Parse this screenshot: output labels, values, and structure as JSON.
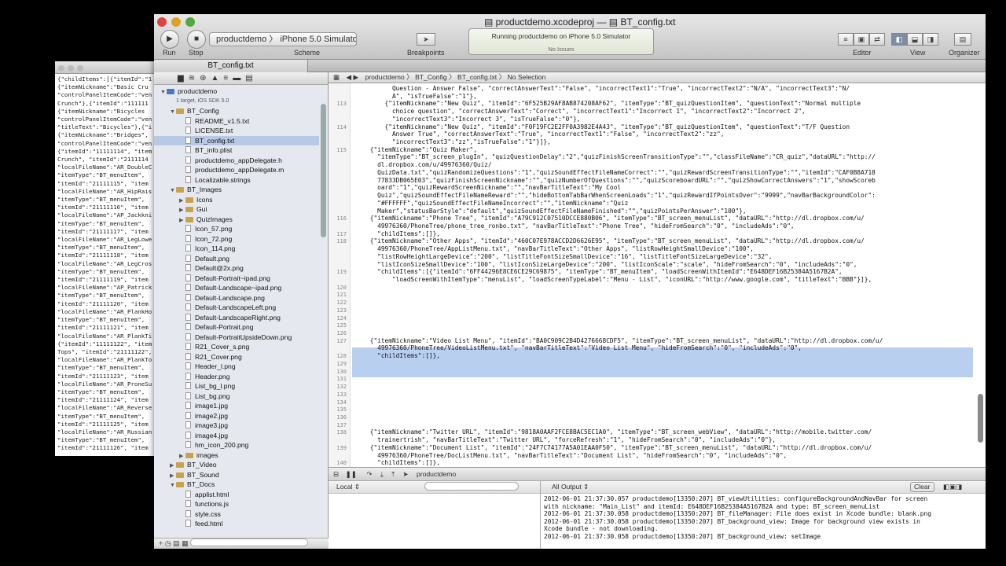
{
  "background_window": {
    "lines": [
      "{\"childItems\":[{\"itemId\":\"1",
      "{\"itemNickname\":\"Basic Cru",
      "\"controlPanelItemCode\":\"ven",
      "Crunch\"},{\"itemId\":\"111111",
      "{\"itemNickname\":\"Bicycles",
      "\"controlPanelItemCode\":\"ven",
      "\"titleText\":\"Bicycles\"},{\"i",
      "{\"itemNickname\":\"Bridges\",",
      "\"controlPanelItemCode\":\"ven",
      "{\"itemId\":\"11111114\", \"item",
      "Crunch\", \"itemId\":\"2111114",
      "\"localFileName\":\"AR_DoubleC",
      "\"itemType\":\"BT_menuItem\",",
      "\"itemId\":\"21111115\", \"item",
      "\"localFileName\":\"AR_HipRais",
      "\"itemType\":\"BT_menuItem\",",
      "\"itemId\":\"21111116\", \"item",
      "\"localFileName\":\"AP_Jackkni",
      "\"itemType\":\"BT_menuItem\",",
      "\"itemId\":\"21111117\", \"item",
      "\"localFileName\":\"AR_LegLowe",
      "\"itemType\":\"BT_menuItem\",",
      "\"itemId\":\"21111118\", \"item",
      "\"localFileName\":\"AR_LegCros",
      "\"itemType\":\"BT_menuItem\",",
      "\"itemId\":\"21111119\", \"item",
      "\"localFileName\":\"AP_Patrick",
      "\"itemType\":\"BT_menuItem\",",
      "\"itemId\":\"21111120\", \"item",
      "\"localFileName\":\"AR_PlankHo",
      "\"itemType\":\"BT_menuItem\",",
      "\"itemId\":\"21111121\", \"item",
      "\"localFileName\":\"AR_PlankTi",
      "{\"itemId\":\"11111122\", \"item",
      "Tops\", \"itemId\":\"21111122\",",
      "\"localFileName\":\"AR_PlankTo",
      "\"itemType\":\"BT_menuItem\",",
      "\"itemId\":\"21111123\", \"item",
      "\"localFileName\":\"AR_ProneSu",
      "\"itemType\":\"BT_menuItem\",",
      "\"itemId\":\"21111124\", \"item",
      "\"localFileName\":\"AR_Reverse",
      "\"itemType\":\"BT_menuItem\",",
      "\"itemId\":\"21111125\", \"item",
      "\"localFileName\":\"AR_Russian",
      "\"itemType\":\"BT_menuItem\",",
      "\"itemId\":\"21111126\", \"item"
    ]
  },
  "window": {
    "title_project": "productdemo.xcodeproj",
    "title_sep": "—",
    "title_file": "BT_config.txt",
    "run_label": "Run",
    "stop_label": "Stop",
    "scheme_label": "Scheme",
    "scheme_text": "productdemo 〉 iPhone 5.0 Simulator",
    "breakpoints_label": "Breakpoints",
    "activity_line1": "Running productdemo on iPhone 5.0 Simulator",
    "activity_line2": "No Issues",
    "editor_label": "Editor",
    "view_label": "View",
    "organizer_label": "Organizer",
    "tab_title": "BT_config.txt"
  },
  "navigator": {
    "items": [
      {
        "label": "productdemo",
        "indent": 0,
        "kind": "proj",
        "open": true
      },
      {
        "label": "1 target, iOS SDK 5.0",
        "indent": 1,
        "kind": "sub"
      },
      {
        "label": "BT_Config",
        "indent": 1,
        "kind": "folder",
        "open": true
      },
      {
        "label": "README_v1.5.txt",
        "indent": 2,
        "kind": "file"
      },
      {
        "label": "LICENSE.txt",
        "indent": 2,
        "kind": "file"
      },
      {
        "label": "BT_config.txt",
        "indent": 2,
        "kind": "file",
        "selected": true
      },
      {
        "label": "BT_info.plist",
        "indent": 2,
        "kind": "file"
      },
      {
        "label": "productdemo_appDelegate.h",
        "indent": 2,
        "kind": "file"
      },
      {
        "label": "productdemo_appDelegate.m",
        "indent": 2,
        "kind": "file"
      },
      {
        "label": "Localizable.strings",
        "indent": 2,
        "kind": "file"
      },
      {
        "label": "BT_Images",
        "indent": 1,
        "kind": "folder",
        "open": true
      },
      {
        "label": "Icons",
        "indent": 2,
        "kind": "folder"
      },
      {
        "label": "Gui",
        "indent": 2,
        "kind": "folder"
      },
      {
        "label": "QuizImages",
        "indent": 2,
        "kind": "folder"
      },
      {
        "label": "Icon_57.png",
        "indent": 2,
        "kind": "file"
      },
      {
        "label": "Icon_72.png",
        "indent": 2,
        "kind": "file"
      },
      {
        "label": "Icon_114.png",
        "indent": 2,
        "kind": "file"
      },
      {
        "label": "Default.png",
        "indent": 2,
        "kind": "file"
      },
      {
        "label": "Default@2x.png",
        "indent": 2,
        "kind": "file"
      },
      {
        "label": "Default-Portrait~ipad.png",
        "indent": 2,
        "kind": "file"
      },
      {
        "label": "Default-Landscape~ipad.png",
        "indent": 2,
        "kind": "file"
      },
      {
        "label": "Default-Landscape.png",
        "indent": 2,
        "kind": "file"
      },
      {
        "label": "Default-LandscapeLeft.png",
        "indent": 2,
        "kind": "file"
      },
      {
        "label": "Default-LandscapeRight.png",
        "indent": 2,
        "kind": "file"
      },
      {
        "label": "Default-Portrait.png",
        "indent": 2,
        "kind": "file"
      },
      {
        "label": "Default-PortraitUpsideDown.png",
        "indent": 2,
        "kind": "file"
      },
      {
        "label": "R21_Cover_s.png",
        "indent": 2,
        "kind": "file"
      },
      {
        "label": "R21_Cover.png",
        "indent": 2,
        "kind": "file"
      },
      {
        "label": "Header_l.png",
        "indent": 2,
        "kind": "file"
      },
      {
        "label": "Header.png",
        "indent": 2,
        "kind": "file"
      },
      {
        "label": "List_bg_l.png",
        "indent": 2,
        "kind": "file"
      },
      {
        "label": "List_bg.png",
        "indent": 2,
        "kind": "file"
      },
      {
        "label": "image1.jpg",
        "indent": 2,
        "kind": "file"
      },
      {
        "label": "image2.jpg",
        "indent": 2,
        "kind": "file"
      },
      {
        "label": "image3.jpg",
        "indent": 2,
        "kind": "file"
      },
      {
        "label": "image4.jpg",
        "indent": 2,
        "kind": "file"
      },
      {
        "label": "hm_icon_200.png",
        "indent": 2,
        "kind": "file"
      },
      {
        "label": "images",
        "indent": 2,
        "kind": "folder"
      },
      {
        "label": "BT_Video",
        "indent": 1,
        "kind": "folder"
      },
      {
        "label": "BT_Sound",
        "indent": 1,
        "kind": "folder"
      },
      {
        "label": "BT_Docs",
        "indent": 1,
        "kind": "folder",
        "open": true
      },
      {
        "label": "applist.html",
        "indent": 2,
        "kind": "file"
      },
      {
        "label": "functions.js",
        "indent": 2,
        "kind": "file"
      },
      {
        "label": "style.css",
        "indent": 2,
        "kind": "file"
      },
      {
        "label": "feed.html",
        "indent": 2,
        "kind": "file"
      }
    ],
    "bottom_bar": "+"
  },
  "jumpbar": {
    "crumbs": [
      "productdemo",
      "BT_Config",
      "BT_config.txt",
      "No Selection"
    ]
  },
  "editor": {
    "lines": [
      {
        "n": "",
        "t": "          Question - Answer False\", \"correctAnswerText\":\"False\", \"incorrectText1\":\"True\", \"incorrectText2\":\"N/A\", \"incorrectText3\":\"N/"
      },
      {
        "n": "",
        "t": "          A\", \"isTrueFalse\":\"1\"},"
      },
      {
        "n": "113",
        "t": "        {\"itemNickname\":\"New Quiz\", \"itemId\":\"6F525B29AF8AB874208AF62\", \"itemType\":\"BT_quizQuestionItem\", \"questionText\":\"Normal multiple"
      },
      {
        "n": "",
        "t": "          choice question\", \"correctAnswerText\":\"Correct\", \"incorrectText1\":\"Incorrect 1\", \"incorrectText2\":\"Incorrect 2\","
      },
      {
        "n": "",
        "t": "          \"incorrectText3\":\"Incorrect 3\", \"isTrueFalse\":\"0\"},"
      },
      {
        "n": "114",
        "t": "        {\"itemNickname\":\"New Quiz\", \"itemId\":\"F0F19FC2E2FF0A3982E4A43\", \"itemType\":\"BT_quizQuestionItem\", \"questionText\":\"T/F Question"
      },
      {
        "n": "",
        "t": "          Answer True\", \"correctAnswerText\":\"True\", \"incorrectText1\":\"False\", \"incorrectText2\":\"zz\","
      },
      {
        "n": "",
        "t": "          \"incorrectText3\":\"zz\",\"isTrueFalse\":\"1\"}]},"
      },
      {
        "n": "115",
        "t": "    {\"itemNickname\":\"Quiz Maker\","
      },
      {
        "n": "",
        "t": "      \"itemType\":\"BT_screen_plugIn\", \"quizQuestionDelay\":\"2\",\"quizFinishScreenTransitionType\":\"\",\"classFileName\":\"CR_quiz\",\"dataURL\":\"http://"
      },
      {
        "n": "",
        "t": "      dl.dropbox.com/u/49976360/Quiz/"
      },
      {
        "n": "",
        "t": "      QuizData.txt\",\"quizRandomizeQuestions\":\"1\",\"quizSoundEffectFileNameCorrect\":\"\",\"quizRewardScreenTransitionType\":\"\",\"itemId\":\"CAF0B8A718"
      },
      {
        "n": "",
        "t": "      77833DB065E03\",\"quizFinishScreenNickname\":\"\",\"quizNumberOfQuestions\":\"\",\"quizScoreboardURL\":\"\",\"quizShowCorrectAnswers\":\"1\",\"showScoreb"
      },
      {
        "n": "",
        "t": "      oard\":\"1\",\"quizRewardScreenNickname\":\"\",\"navBarTitleText\":\"My Cool"
      },
      {
        "n": "",
        "t": "      Quiz\",\"quizSoundEffectFileNameReward\":\"\",\"hideBottomTabBarWhenScreenLoads\":\"1\",\"quizRewardIfPointsOver\":\"9999\",\"navBarBackgroundColor\":"
      },
      {
        "n": "",
        "t": "      \"#FFFFFF\",\"quizSoundEffectFileNameIncorrect\":\"\",\"itemNickname\":\"Quiz"
      },
      {
        "n": "",
        "t": "      Maker\",\"statusBarStyle\":\"default\",\"quizSoundEffectFileNameFinished\":\"\",\"quizPointsPerAnswer\":\"100\"},"
      },
      {
        "n": "116",
        "t": "    {\"itemNickname\":\"Phone Tree\", \"itemId\":\"A79C912C07510DCCE880B06\", \"itemType\":\"BT_screen_menuList\", \"dataURL\":\"http://dl.dropbox.com/u/"
      },
      {
        "n": "",
        "t": "      49976360/PhoneTree/phone_tree_ronbo.txt\", \"navBarTitleText\":\"Phone Tree\", \"hideFromSearch\":\"0\", \"includeAds\":\"0\","
      },
      {
        "n": "117",
        "t": "      \"childItems\":[]},"
      },
      {
        "n": "118",
        "t": "    {\"itemNickname\":\"Other Apps\", \"itemId\":\"460C07E978ACCD2D6626E95\", \"itemType\":\"BT_screen_menuList\", \"dataURL\":\"http://dl.dropbox.com/u/"
      },
      {
        "n": "",
        "t": "      49976360/PhoneTree/AppListMenu.txt\", \"navBarTitleText\":\"Other Apps\", \"listRowHeightSmallDevice\":\"100\","
      },
      {
        "n": "",
        "t": "      \"listRowHeightLargeDevice\":\"200\", \"listTitleFontSizeSmallDevice\":\"16\", \"listTitleFontSizeLargeDevice\":\"32\","
      },
      {
        "n": "",
        "t": "      \"listIconSizeSmallDevice\":\"100\", \"listIconSizeLargeDevice\":\"200\", \"listIconScale\":\"scale\", \"hideFromSearch\":\"0\", \"includeAds\":\"0\","
      },
      {
        "n": "119",
        "t": "      \"childItems\":[{\"itemId\":\"6FF44296E8CE6CE29C69875\", \"itemType\":\"BT_menuItem\", \"loadScreenWithItemId\":\"E648DEF16B25384A5167B2A\","
      },
      {
        "n": "",
        "t": "          \"loadScreenWithItemType\":\"menuList\", \"loadScreenTypeLabel\":\"Menu - List\", \"iconURL\":\"http://www.google.com\", \"titleText\":\"BBB\"}]},"
      },
      {
        "n": "120",
        "t": ""
      },
      {
        "n": "121",
        "t": ""
      },
      {
        "n": "122",
        "t": ""
      },
      {
        "n": "123",
        "t": ""
      },
      {
        "n": "124",
        "t": ""
      },
      {
        "n": "125",
        "t": ""
      },
      {
        "n": "126",
        "t": ""
      },
      {
        "n": "127",
        "t": "    {\"itemNickname\":\"Video List Menu\", \"itemId\":\"BA0C909C2B4D4276668CDF5\", \"itemType\":\"BT_screen_menuList\", \"dataURL\":\"http://dl.dropbox.com/u/"
      },
      {
        "n": "",
        "t": "      49976360/PhoneTree/VideoListMenu.txt\", \"navBarTitleText\":\"Video List Menu\", \"hideFromSearch\":\"0\", \"includeAds\":\"0\","
      },
      {
        "n": "128",
        "t": "      \"childItems\":[]},"
      },
      {
        "n": "129",
        "t": ""
      },
      {
        "n": "130",
        "t": ""
      },
      {
        "n": "131",
        "t": ""
      },
      {
        "n": "132",
        "t": ""
      },
      {
        "n": "133",
        "t": ""
      },
      {
        "n": "134",
        "t": ""
      },
      {
        "n": "135",
        "t": ""
      },
      {
        "n": "136",
        "t": ""
      },
      {
        "n": "137",
        "t": ""
      },
      {
        "n": "138",
        "t": "    {\"itemNickname\":\"Twitter URL\", \"itemId\":\"9818A0AAF2FCE8BAC5EC1A0\", \"itemType\":\"BT_screen_webView\", \"dataURL\":\"http://mobile.twitter.com/"
      },
      {
        "n": "",
        "t": "      trainertrish\", \"navBarTitleText\":\"Twitter URL\", \"forceRefresh\":\"1\", \"hideFromSearch\":\"0\", \"includeAds\":\"0\"},"
      },
      {
        "n": "139",
        "t": "    {\"itemNickname\":\"Document List\", \"itemId\":\"24F7C74177A5A01EAA0F50\", \"itemType\":\"BT_screen_menuList\", \"dataURL\":\"http://dl.dropbox.com/u/"
      },
      {
        "n": "",
        "t": "      49976360/PhoneTree/DocListMenu.txt\", \"navBarTitleText\":\"Document List\", \"hideFromSearch\":\"0\", \"includeAds\":\"0\","
      },
      {
        "n": "140",
        "t": "      \"childItems\":[]},"
      }
    ]
  },
  "debug": {
    "process": "productdemo",
    "local_label": "Local ⇕",
    "all_output": "All Output ⇕",
    "clear": "Clear",
    "console_lines": [
      "2012-06-01 21:37:30.057 productdemo[13350:207] BT_viewUtilities: configureBackgroundAndNavBar for screen",
      "with nickname: \"Main_List\" and itemId: E648DEF16B25384A5167B2A and type: BT_screen_menuList",
      "2012-06-01 21:37:30.058 productdemo[13350:207] BT_fileManager: File does exist in Xcode bundle: blank.png",
      "2012-06-01 21:37:30.058 productdemo[13350:207] BT_background_view: Image for background view exists in",
      "Xcode bundle - not downloading.",
      "2012-06-01 21:37:30.058 productdemo[13350:207] BT_background_view: setImage"
    ]
  },
  "colors": {
    "selection": "#b7c9e4",
    "highlight": "#b9cff0",
    "folder": "#c9a24a"
  }
}
